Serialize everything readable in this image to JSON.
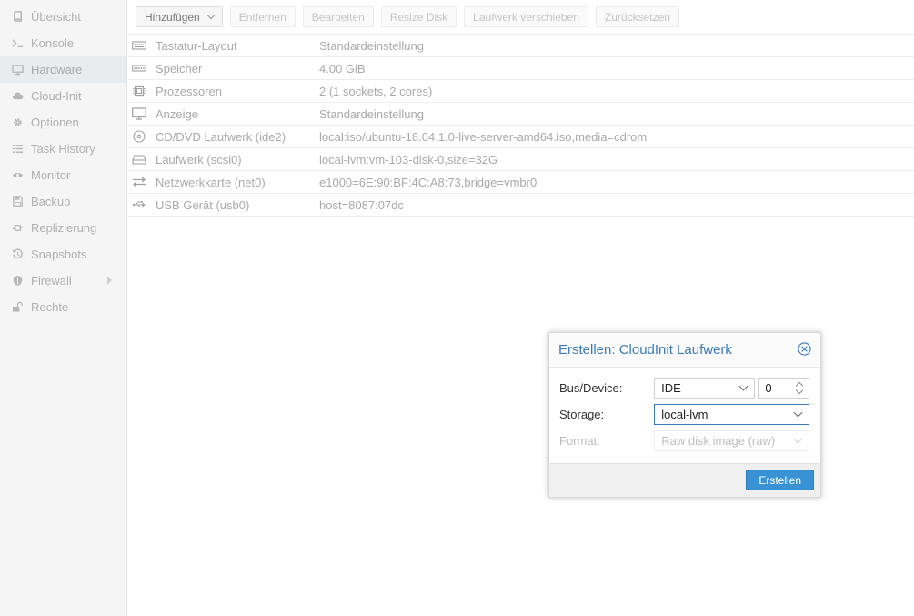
{
  "sidebar": {
    "items": [
      {
        "label": "Übersicht",
        "icon": "book-icon"
      },
      {
        "label": "Konsole",
        "icon": "terminal-icon"
      },
      {
        "label": "Hardware",
        "icon": "desktop-icon"
      },
      {
        "label": "Cloud-Init",
        "icon": "cloud-icon"
      },
      {
        "label": "Optionen",
        "icon": "gear-icon"
      },
      {
        "label": "Task History",
        "icon": "list-icon"
      },
      {
        "label": "Monitor",
        "icon": "eye-icon"
      },
      {
        "label": "Backup",
        "icon": "floppy-icon"
      },
      {
        "label": "Replizierung",
        "icon": "retweet-icon"
      },
      {
        "label": "Snapshots",
        "icon": "history-icon"
      },
      {
        "label": "Firewall",
        "icon": "shield-icon"
      },
      {
        "label": "Rechte",
        "icon": "unlock-icon"
      }
    ],
    "active": "Hardware"
  },
  "toolbar": {
    "add_label": "Hinzufügen",
    "remove_label": "Entfernen",
    "edit_label": "Bearbeiten",
    "resize_label": "Resize Disk",
    "move_label": "Laufwerk verschieben",
    "revert_label": "Zurücksetzen"
  },
  "hardware": {
    "rows": [
      {
        "name": "Tastatur-Layout",
        "value": "Standardeinstellung",
        "icon": "keyboard-icon"
      },
      {
        "name": "Speicher",
        "value": "4.00 GiB",
        "icon": "memory-icon"
      },
      {
        "name": "Prozessoren",
        "value": "2 (1 sockets, 2 cores)",
        "icon": "cpu-icon"
      },
      {
        "name": "Anzeige",
        "value": "Standardeinstellung",
        "icon": "monitor-icon"
      },
      {
        "name": "CD/DVD Laufwerk (ide2)",
        "value": "local:iso/ubuntu-18.04.1.0-live-server-amd64.iso,media=cdrom",
        "icon": "cdrom-icon"
      },
      {
        "name": "Laufwerk (scsi0)",
        "value": "local-lvm:vm-103-disk-0,size=32G",
        "icon": "hdd-icon"
      },
      {
        "name": "Netzwerkkarte (net0)",
        "value": "e1000=6E:90:BF:4C:A8:73,bridge=vmbr0",
        "icon": "exchange-icon"
      },
      {
        "name": "USB Gerät (usb0)",
        "value": "host=8087:07dc",
        "icon": "usb-icon"
      }
    ]
  },
  "dialog": {
    "title": "Erstellen: CloudInit Laufwerk",
    "bus_label": "Bus/Device:",
    "bus_value": "IDE",
    "device_value": "0",
    "storage_label": "Storage:",
    "storage_value": "local-lvm",
    "format_label": "Format:",
    "format_value": "Raw disk image (raw)",
    "create_label": "Erstellen",
    "accent": "#3892d4"
  }
}
